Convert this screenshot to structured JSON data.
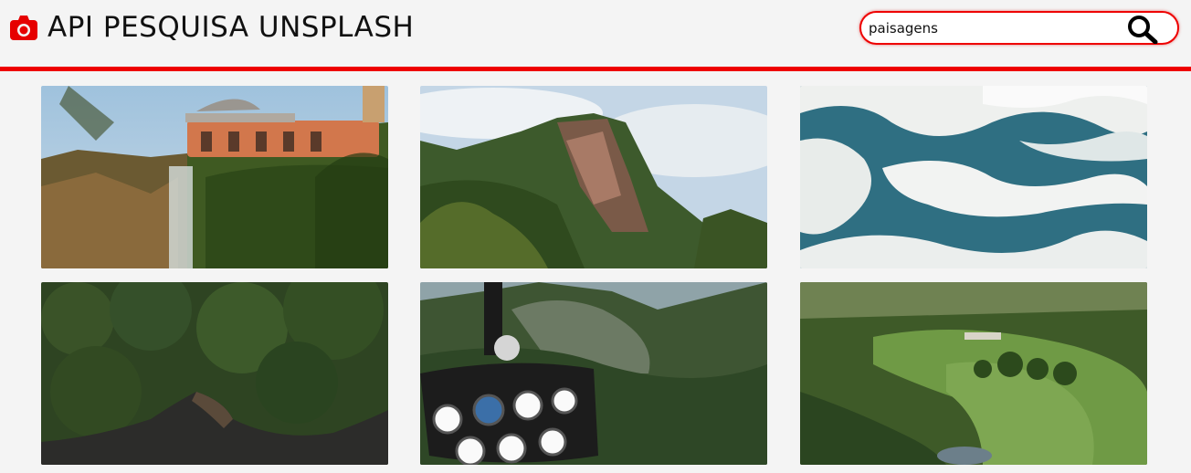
{
  "header": {
    "title": "API PESQUISA UNSPLASH",
    "accent_color": "#e60000",
    "logo_icon": "camera-icon"
  },
  "search": {
    "value": "paisagens",
    "button_icon": "search-icon"
  },
  "gallery": {
    "items": [
      {
        "subject": "waterfall-observation-tower"
      },
      {
        "subject": "green-mountain-peak"
      },
      {
        "subject": "white-dunes-blue-lagoons"
      },
      {
        "subject": "forest-and-river-aerial"
      },
      {
        "subject": "helicopter-cockpit-mountains"
      },
      {
        "subject": "farm-fields-aerial"
      }
    ]
  }
}
